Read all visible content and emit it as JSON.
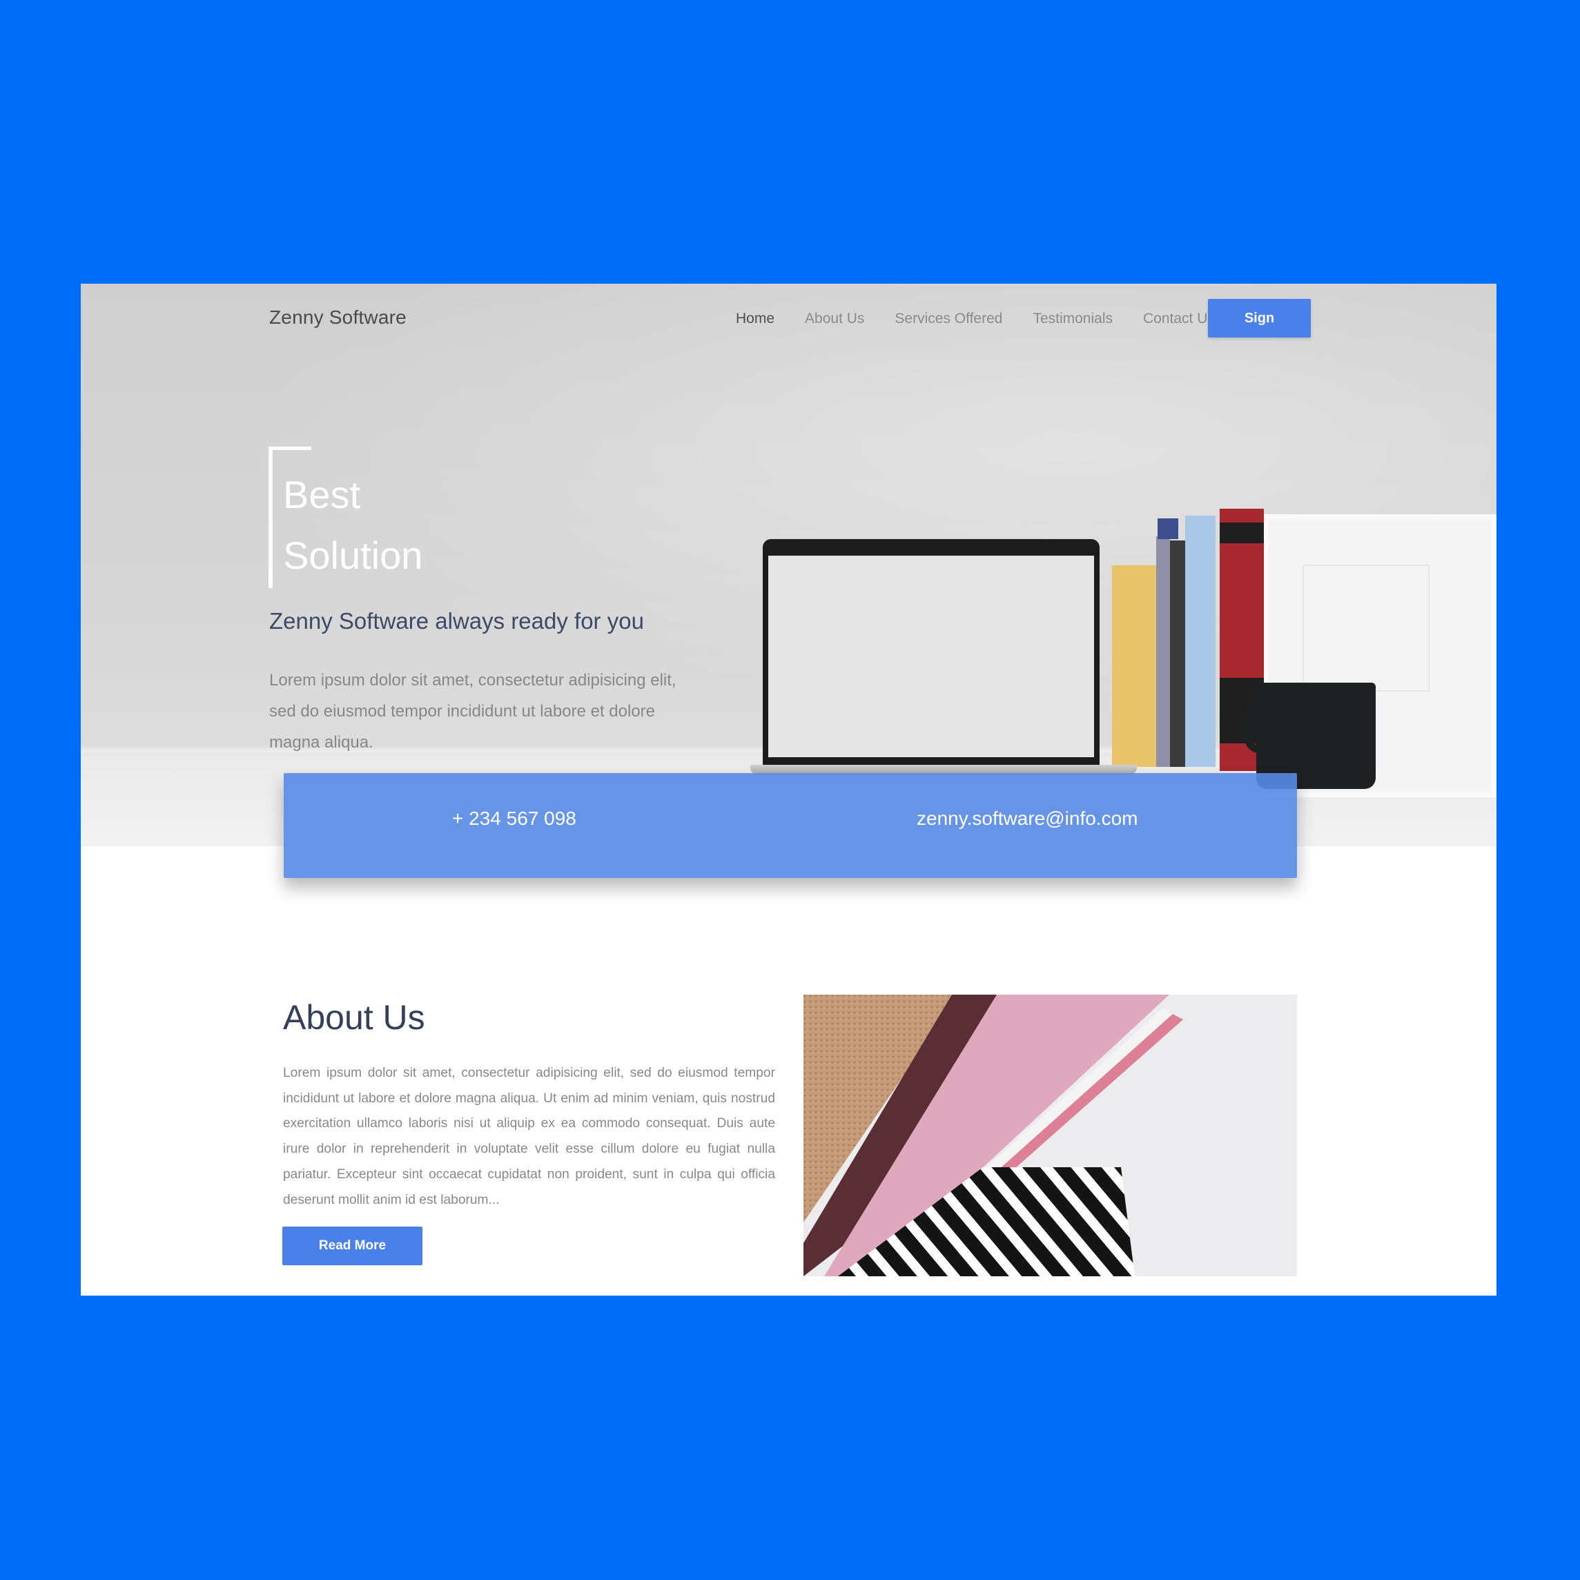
{
  "header": {
    "brand": "Zenny Software",
    "nav": [
      "Home",
      "About Us",
      "Services Offered",
      "Testimonials",
      "Contact Us"
    ],
    "sign_label": "Sign"
  },
  "hero": {
    "title_line1": "Best",
    "title_line2": "Solution",
    "subtitle": "Zenny Software always ready for you",
    "text": "Lorem ipsum dolor sit amet, consectetur adipisicing elit, sed do eiusmod tempor incididunt ut labore et dolore magna aliqua."
  },
  "contact": {
    "phone": "+ 234 567 098",
    "email": "zenny.software@info.com"
  },
  "about": {
    "title": "About Us",
    "text": "Lorem ipsum dolor sit amet, consectetur adipisicing elit, sed do eiusmod tempor incididunt ut labore et dolore magna aliqua. Ut enim ad minim veniam, quis nostrud exercitation ullamco laboris nisi ut aliquip ex ea commodo consequat. Duis aute irure dolor in reprehenderit in voluptate velit esse cillum dolore eu fugiat nulla pariatur. Excepteur sint occaecat cupidatat non proident, sunt in culpa qui officia deserunt mollit anim id est laborum...",
    "read_more_label": "Read More"
  },
  "colors": {
    "background": "#006ef9",
    "accent": "#4a80ea",
    "heading": "#34405a"
  }
}
